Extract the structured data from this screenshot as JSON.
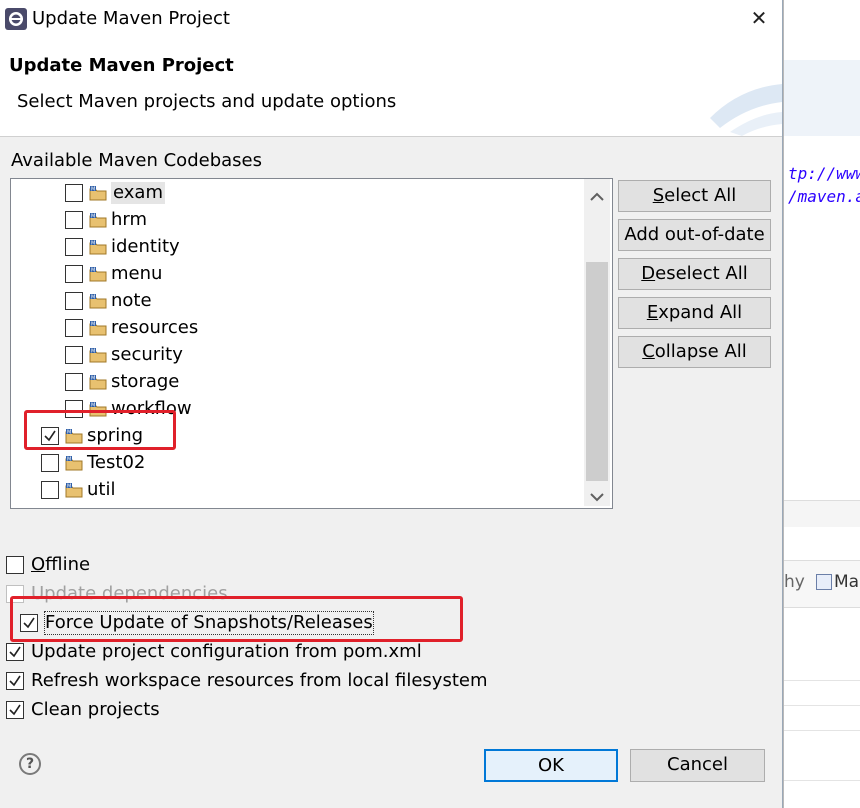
{
  "window": {
    "title": "Update Maven Project",
    "close_glyph": "✕"
  },
  "banner": {
    "title": "Update Maven Project",
    "subtitle": "Select Maven projects and update options"
  },
  "codebases": {
    "label": "Available Maven Codebases",
    "items": [
      {
        "label": "exam",
        "checked": false,
        "level": 2
      },
      {
        "label": "hrm",
        "checked": false,
        "level": 2
      },
      {
        "label": "identity",
        "checked": false,
        "level": 2
      },
      {
        "label": "menu",
        "checked": false,
        "level": 2
      },
      {
        "label": "note",
        "checked": false,
        "level": 2
      },
      {
        "label": "resources",
        "checked": false,
        "level": 2
      },
      {
        "label": "security",
        "checked": false,
        "level": 2
      },
      {
        "label": "storage",
        "checked": false,
        "level": 2
      },
      {
        "label": "workflow",
        "checked": false,
        "level": 2
      },
      {
        "label": "spring",
        "checked": true,
        "level": 1
      },
      {
        "label": "Test02",
        "checked": false,
        "level": 1
      },
      {
        "label": "util",
        "checked": false,
        "level": 1
      }
    ]
  },
  "side_buttons": {
    "select_all": {
      "mnemonic": "S",
      "rest": "elect All"
    },
    "add_out_of_date": "Add out-of-date",
    "deselect_all": {
      "mnemonic": "D",
      "rest": "eselect All"
    },
    "expand_all": {
      "mnemonic": "E",
      "rest": "xpand All"
    },
    "collapse_all": {
      "mnemonic": "C",
      "rest": "ollapse All"
    }
  },
  "options": {
    "offline": {
      "mnemonic": "O",
      "rest": "ffline",
      "checked": false
    },
    "update_dependencies": {
      "label": "Update dependencies",
      "checked": false,
      "enabled": false
    },
    "force_update": {
      "label": "Force Update of Snapshots/Releases",
      "checked": true
    },
    "update_config": {
      "label": "Update project configuration from pom.xml",
      "checked": true
    },
    "refresh_workspace": {
      "label": "Refresh workspace resources from local filesystem",
      "checked": true
    },
    "clean_projects": {
      "label": "Clean projects",
      "checked": true
    }
  },
  "footer": {
    "help_glyph": "?",
    "ok_label": "OK",
    "cancel_label": "Cancel"
  },
  "background": {
    "code_line1": "tp://www",
    "code_line2": "/maven.a",
    "tab_text1": "hy",
    "tab_text2": "Ma"
  },
  "colors": {
    "highlight": "#e0202a",
    "accent": "#0078d7"
  }
}
